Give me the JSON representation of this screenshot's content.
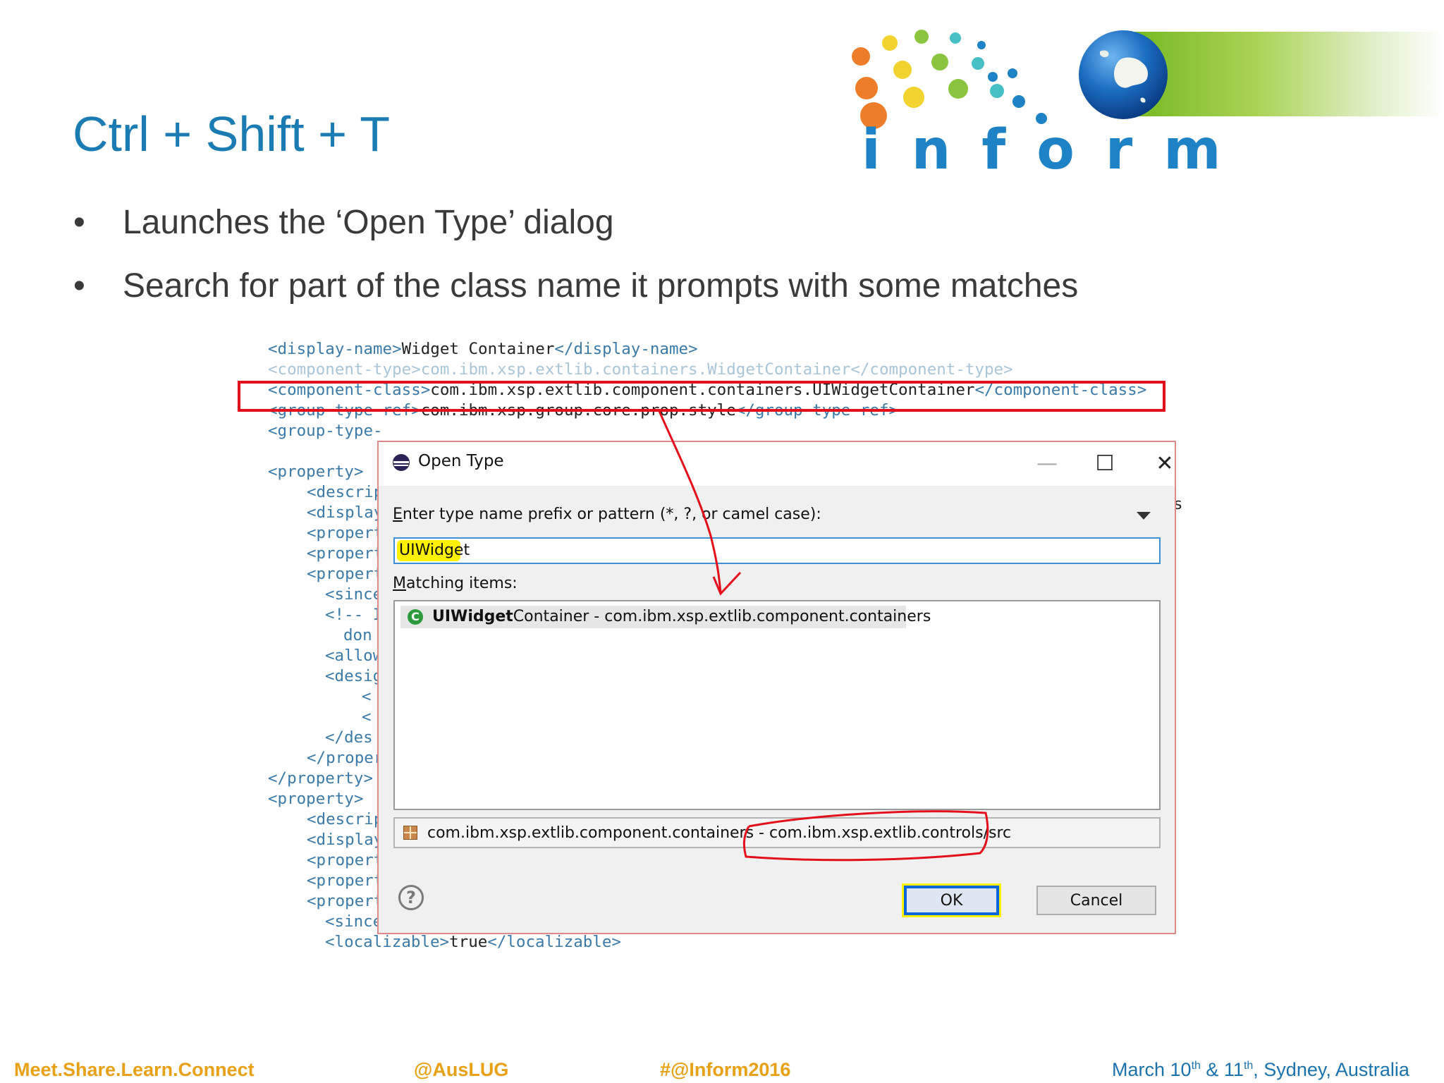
{
  "slide": {
    "title": "Ctrl + Shift + T",
    "bullets": [
      "Launches the ‘Open Type’ dialog",
      "Search for part of the class name it prompts with some matches"
    ],
    "bullet_symbol": "•"
  },
  "logo": {
    "word": "inform",
    "colors": {
      "word": "#1e82c6",
      "bar": "#74b820",
      "globe": "#1c6ec2"
    }
  },
  "code": {
    "lines": [
      {
        "open": "<display-name>",
        "text": "Widget Container",
        "close": "</display-name>"
      },
      {
        "open": "<component-type>",
        "text": "com.ibm.xsp.extlib.containers.WidgetContainer",
        "close": "</component-type>"
      },
      {
        "open": "<component-class>",
        "text": "com.ibm.xsp.extlib.component.containers.UIWidgetContainer",
        "close": "</component-class>"
      },
      {
        "open": "<group-type-ref>",
        "text": "com.ibm.xsp.group.core.prop.style",
        "close": "</group-type-ref>"
      },
      {
        "open": "<group-type-",
        "text": "",
        "close": ""
      },
      {
        "open": "<property>",
        "text": "",
        "close": ""
      },
      {
        "open": "<descrip",
        "text": "",
        "close": ""
      },
      {
        "open": "<display",
        "text": "",
        "close": ""
      },
      {
        "open": "<propert",
        "text": "",
        "close": ""
      },
      {
        "open": "<propert",
        "text": "",
        "close": ""
      },
      {
        "open": "<propert",
        "text": "",
        "close": ""
      },
      {
        "open": "<since",
        "text": "",
        "close": ""
      },
      {
        "open": "<!-- I",
        "text": "",
        "close": ""
      },
      {
        "open": "don",
        "text": "",
        "close": ""
      },
      {
        "open": "<allow",
        "text": "",
        "close": ""
      },
      {
        "open": "<desig",
        "text": "",
        "close": ""
      },
      {
        "open": "<",
        "text": "",
        "close": ""
      },
      {
        "open": "<",
        "text": "",
        "close": ""
      },
      {
        "open": "</des",
        "text": "",
        "close": ""
      },
      {
        "open": "</proper",
        "text": "",
        "close": ""
      },
      {
        "open": "</property>",
        "text": "",
        "close": ""
      },
      {
        "open": "<property>",
        "text": "",
        "close": ""
      },
      {
        "open": "<descrip",
        "text": "",
        "close": ""
      },
      {
        "open": "<display",
        "text": "",
        "close": ""
      },
      {
        "open": "<propert",
        "text": "",
        "close": ""
      },
      {
        "open": "<propert",
        "text": "",
        "close": ""
      },
      {
        "open": "<propert",
        "text": "",
        "close": ""
      },
      {
        "open": "<since",
        "text": "",
        "close": ""
      },
      {
        "open": "<localizable>",
        "text": "true",
        "close": "</localizable>"
      }
    ],
    "stray_char": "s"
  },
  "dialog": {
    "title": "Open Type",
    "window_controls": {
      "minimize": "—",
      "maximize": "☐",
      "close": "✕"
    },
    "prompt": {
      "accel": "E",
      "rest": "nter type name prefix or pattern (*, ?, or camel case):"
    },
    "search": {
      "value": "UIWidget",
      "placeholder": ""
    },
    "matching": {
      "accel": "M",
      "rest": "atching items:"
    },
    "results": [
      {
        "icon": "class-icon",
        "icon_glyph": "C",
        "match": "UIWidget",
        "rest": "Container - com.ibm.xsp.extlib.component.containers"
      }
    ],
    "status": "com.ibm.xsp.extlib.component.containers - com.ibm.xsp.extlib.controls/src",
    "help_glyph": "?",
    "ok_label": "OK",
    "cancel_label": "Cancel"
  },
  "footer": {
    "tagline": "Meet.Share.Learn.Connect",
    "handle": "@AusLUG",
    "hashtag": "#@Inform2016",
    "date_prefix": "March 10",
    "sup1": "th",
    "date_mid": " & 11",
    "sup2": "th",
    "date_suffix": ", Sydney, Australia"
  },
  "colors": {
    "accent": "#1b7bb3",
    "annotation": "#e3101b",
    "highlight": "#fff200",
    "footer_orange": "#e8a117"
  }
}
